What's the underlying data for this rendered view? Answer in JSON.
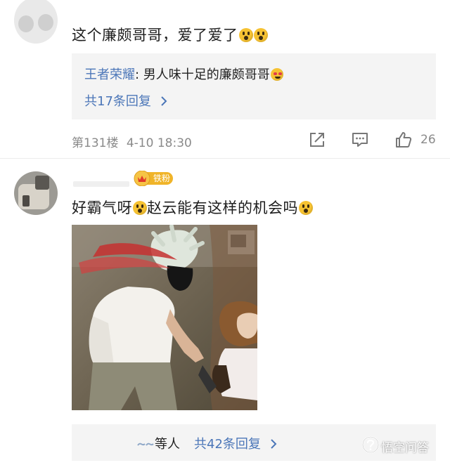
{
  "comment1": {
    "text": "这个廉颇哥哥，爱了爱了",
    "emojis": [
      "scream-emoji",
      "scream-emoji"
    ],
    "reply_preview": {
      "user": "王者荣耀",
      "separator": ":",
      "text": " 男人味十足的廉颇哥哥",
      "emoji": "heart-eyes-emoji"
    },
    "more_replies": "共17条回复",
    "floor": "第131楼",
    "time": "4-10 18:30",
    "likes": "26"
  },
  "comment2": {
    "badge": "铁粉",
    "text_part1": "好霸气呀",
    "text_part2": "赵云能有这样的机会吗",
    "reply_users_suffix": "等人",
    "more_replies": "共42条回复"
  },
  "watermark": {
    "text": "悟空问答"
  },
  "colors": {
    "link_blue": "#4b76b8",
    "meta_gray": "#8a8a8a",
    "reply_bg": "#f4f4f4",
    "badge_gold": "#f0b429"
  }
}
